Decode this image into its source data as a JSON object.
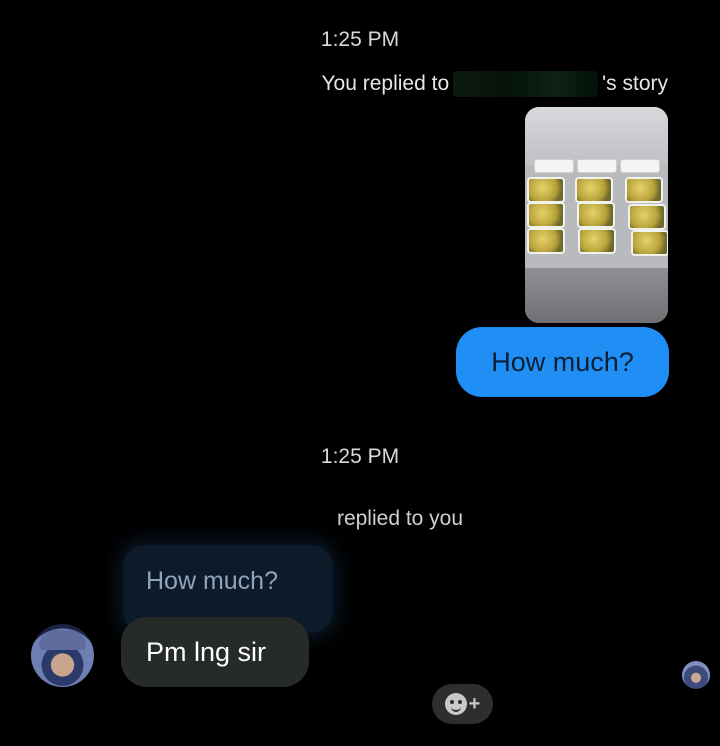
{
  "conversation": {
    "time_1": "1:25 PM",
    "replied_prefix": "You replied to",
    "replied_suffix": "'s story",
    "outgoing_message": "How much?",
    "time_2": "1:25 PM",
    "incoming_reply_label": "replied to you",
    "quoted_message": "How much?",
    "incoming_message": "Pm lng sir"
  },
  "colors": {
    "background": "#000000",
    "outgoing_bubble": "#1f8ff5",
    "incoming_bubble": "#262b28",
    "quote_bubble": "#0c1a2a"
  },
  "icons": {
    "reaction_button": "add-reaction-icon",
    "avatar": "user-avatar",
    "seen_indicator": "seen-avatar"
  }
}
